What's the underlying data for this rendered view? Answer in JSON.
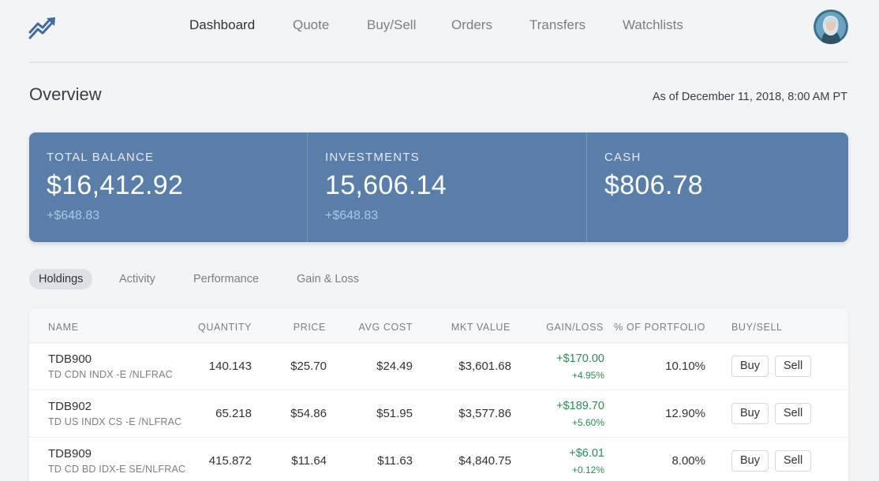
{
  "nav": {
    "items": [
      {
        "label": "Dashboard",
        "active": true
      },
      {
        "label": "Quote",
        "active": false
      },
      {
        "label": "Buy/Sell",
        "active": false
      },
      {
        "label": "Orders",
        "active": false
      },
      {
        "label": "Transfers",
        "active": false
      },
      {
        "label": "Watchlists",
        "active": false
      }
    ]
  },
  "overview": {
    "title": "Overview",
    "as_of": "As of December 11, 2018, 8:00 AM PT"
  },
  "summary": {
    "total_balance": {
      "label": "TOTAL BALANCE",
      "value": "$16,412.92",
      "change": "+$648.83"
    },
    "investments": {
      "label": "INVESTMENTS",
      "value": "15,606.14",
      "change": "+$648.83"
    },
    "cash": {
      "label": "CASH",
      "value": "$806.78"
    }
  },
  "tabs": [
    {
      "label": "Holdings",
      "active": true
    },
    {
      "label": "Activity",
      "active": false
    },
    {
      "label": "Performance",
      "active": false
    },
    {
      "label": "Gain & Loss",
      "active": false
    }
  ],
  "holdings": {
    "columns": {
      "name": "NAME",
      "quantity": "QUANTITY",
      "price": "PRICE",
      "avg_cost": "AVG COST",
      "mkt_value": "MKT VALUE",
      "gain_loss": "GAIN/LOSS",
      "portfolio": "% OF PORTFOLIO",
      "buy_sell": "BUY/SELL"
    },
    "rows": [
      {
        "symbol": "TDB900",
        "description": "TD CDN INDX -E /NLFRAC",
        "quantity": "140.143",
        "price": "$25.70",
        "avg_cost": "$24.49",
        "mkt_value": "$3,601.68",
        "gain": "+$170.00",
        "gain_pct": "+4.95%",
        "portfolio": "10.10%",
        "buy_label": "Buy",
        "sell_label": "Sell"
      },
      {
        "symbol": "TDB902",
        "description": "TD US INDX CS -E /NLFRAC",
        "quantity": "65.218",
        "price": "$54.86",
        "avg_cost": "$51.95",
        "mkt_value": "$3,577.86",
        "gain": "+$189.70",
        "gain_pct": "+5.60%",
        "portfolio": "12.90%",
        "buy_label": "Buy",
        "sell_label": "Sell"
      },
      {
        "symbol": "TDB909",
        "description": "TD CD BD IDX-E SE/NLFRAC",
        "quantity": "415.872",
        "price": "$11.64",
        "avg_cost": "$11.63",
        "mkt_value": "$4,840.75",
        "gain": "+$6.01",
        "gain_pct": "+0.12%",
        "portfolio": "8.00%",
        "buy_label": "Buy",
        "sell_label": "Sell"
      }
    ]
  },
  "colors": {
    "summary_card": "#5b7ea9",
    "gain_positive": "#2e8a57",
    "page_background": "#f2f4f6"
  },
  "icons": {
    "logo": "trending-up-logo-icon",
    "avatar": "user-avatar"
  }
}
